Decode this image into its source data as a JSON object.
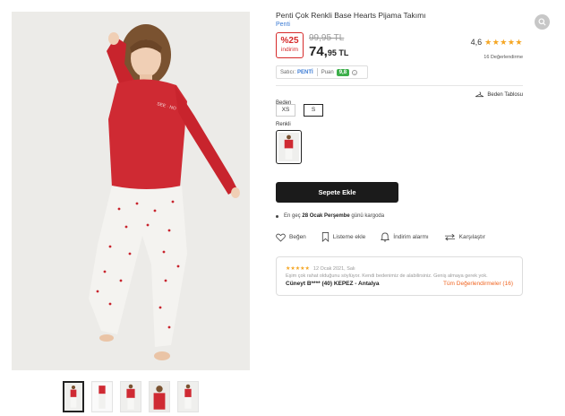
{
  "product": {
    "title": "Penti Çok Renkli Base Hearts Pijama Takımı",
    "brand": "Penti"
  },
  "price": {
    "discount_percent": "%25",
    "discount_label": "indirim",
    "old_price": "99,95 TL",
    "new_price_main": "74,",
    "new_price_cents": "95 TL"
  },
  "rating": {
    "score": "4,6",
    "stars": "★★★★★",
    "count_label": "16 Değerlendirme"
  },
  "seller": {
    "label": "Satıcı:",
    "name": "PENTİ",
    "score_label": "Puan",
    "score": "9,8",
    "info": "i"
  },
  "sizes": {
    "label": "Beden",
    "size_table_label": "Beden Tablosu",
    "options": [
      "XS",
      "S"
    ],
    "selected": "S"
  },
  "colors": {
    "label": "Renkli"
  },
  "cart": {
    "add_to_cart": "Sepete Ekle"
  },
  "delivery": {
    "prefix": "En geç",
    "date": "28 Ocak Perşembe",
    "suffix": "günü kargoda"
  },
  "actions": {
    "like": "Beğen",
    "add_to_list": "Listeme ekle",
    "discount_alert": "İndirim alarmı",
    "compare": "Karşılaştır"
  },
  "review": {
    "stars": "★★★★★",
    "date": "12 Ocak 2021, Salı",
    "text": "Eşim çok rahat olduğunu söylüyor. Kendi bedenimiz de alabilirsiniz. Geniş almaya gerek yok.",
    "author": "Cüneyt B**** (40) KEPEZ - Antalya",
    "all_reviews": "Tüm Değerlendirmeler (16)"
  },
  "icons": {
    "search": "search-icon",
    "heart": "heart-icon",
    "bookmark": "bookmark-icon",
    "bell": "bell-icon",
    "compare": "compare-arrows-icon",
    "hanger": "hanger-icon"
  },
  "colors_theme": {
    "accent_red": "#d62a2a",
    "brand_blue": "#3b7bd4",
    "star": "#f5a623",
    "score_green": "#3cae4a",
    "review_link": "#f06522",
    "button_dark": "#1b1b1b"
  }
}
